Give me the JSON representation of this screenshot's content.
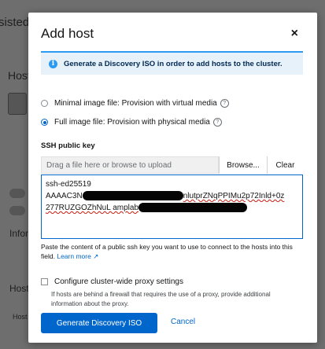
{
  "background": {
    "title_fragment": "sisted",
    "hosts_fragment": "Host",
    "info_fragment": "Infor",
    "host_fragment": "Host",
    "tab_fragment": "Host"
  },
  "modal": {
    "title": "Add host",
    "close_label": "×",
    "alert": {
      "icon": "info-icon",
      "text": "Generate a Discovery ISO in order to add hosts to the cluster."
    },
    "image_options": [
      {
        "label": "Minimal image file: Provision with virtual media",
        "checked": false
      },
      {
        "label": "Full image file: Provision with physical media",
        "checked": true
      }
    ],
    "ssh": {
      "label": "SSH public key",
      "upload_placeholder": "Drag a file here or browse to upload",
      "browse_label": "Browse...",
      "clear_label": "Clear",
      "value_line1": "ssh-ed25519",
      "value_line2_start": "AAAAC3N",
      "value_line2_end": "nlutprZNqPPIMu2p72Inld+0z",
      "value_line3_start": "277RUZGOZhNuL amplab"
    },
    "helper_text": "Paste the content of a public ssh key you want to use to connect to the hosts into this field.",
    "learn_more": "Learn more",
    "proxy": {
      "label": "Configure cluster-wide proxy settings",
      "description": "If hosts are behind a firewall that requires the use of a proxy, provide additional information about the proxy."
    },
    "primary_button": "Generate Discovery ISO",
    "cancel_button": "Cancel"
  },
  "colors": {
    "primary": "#0066cc",
    "alert_bg": "#e7f1fa",
    "alert_accent": "#2b9af3"
  }
}
